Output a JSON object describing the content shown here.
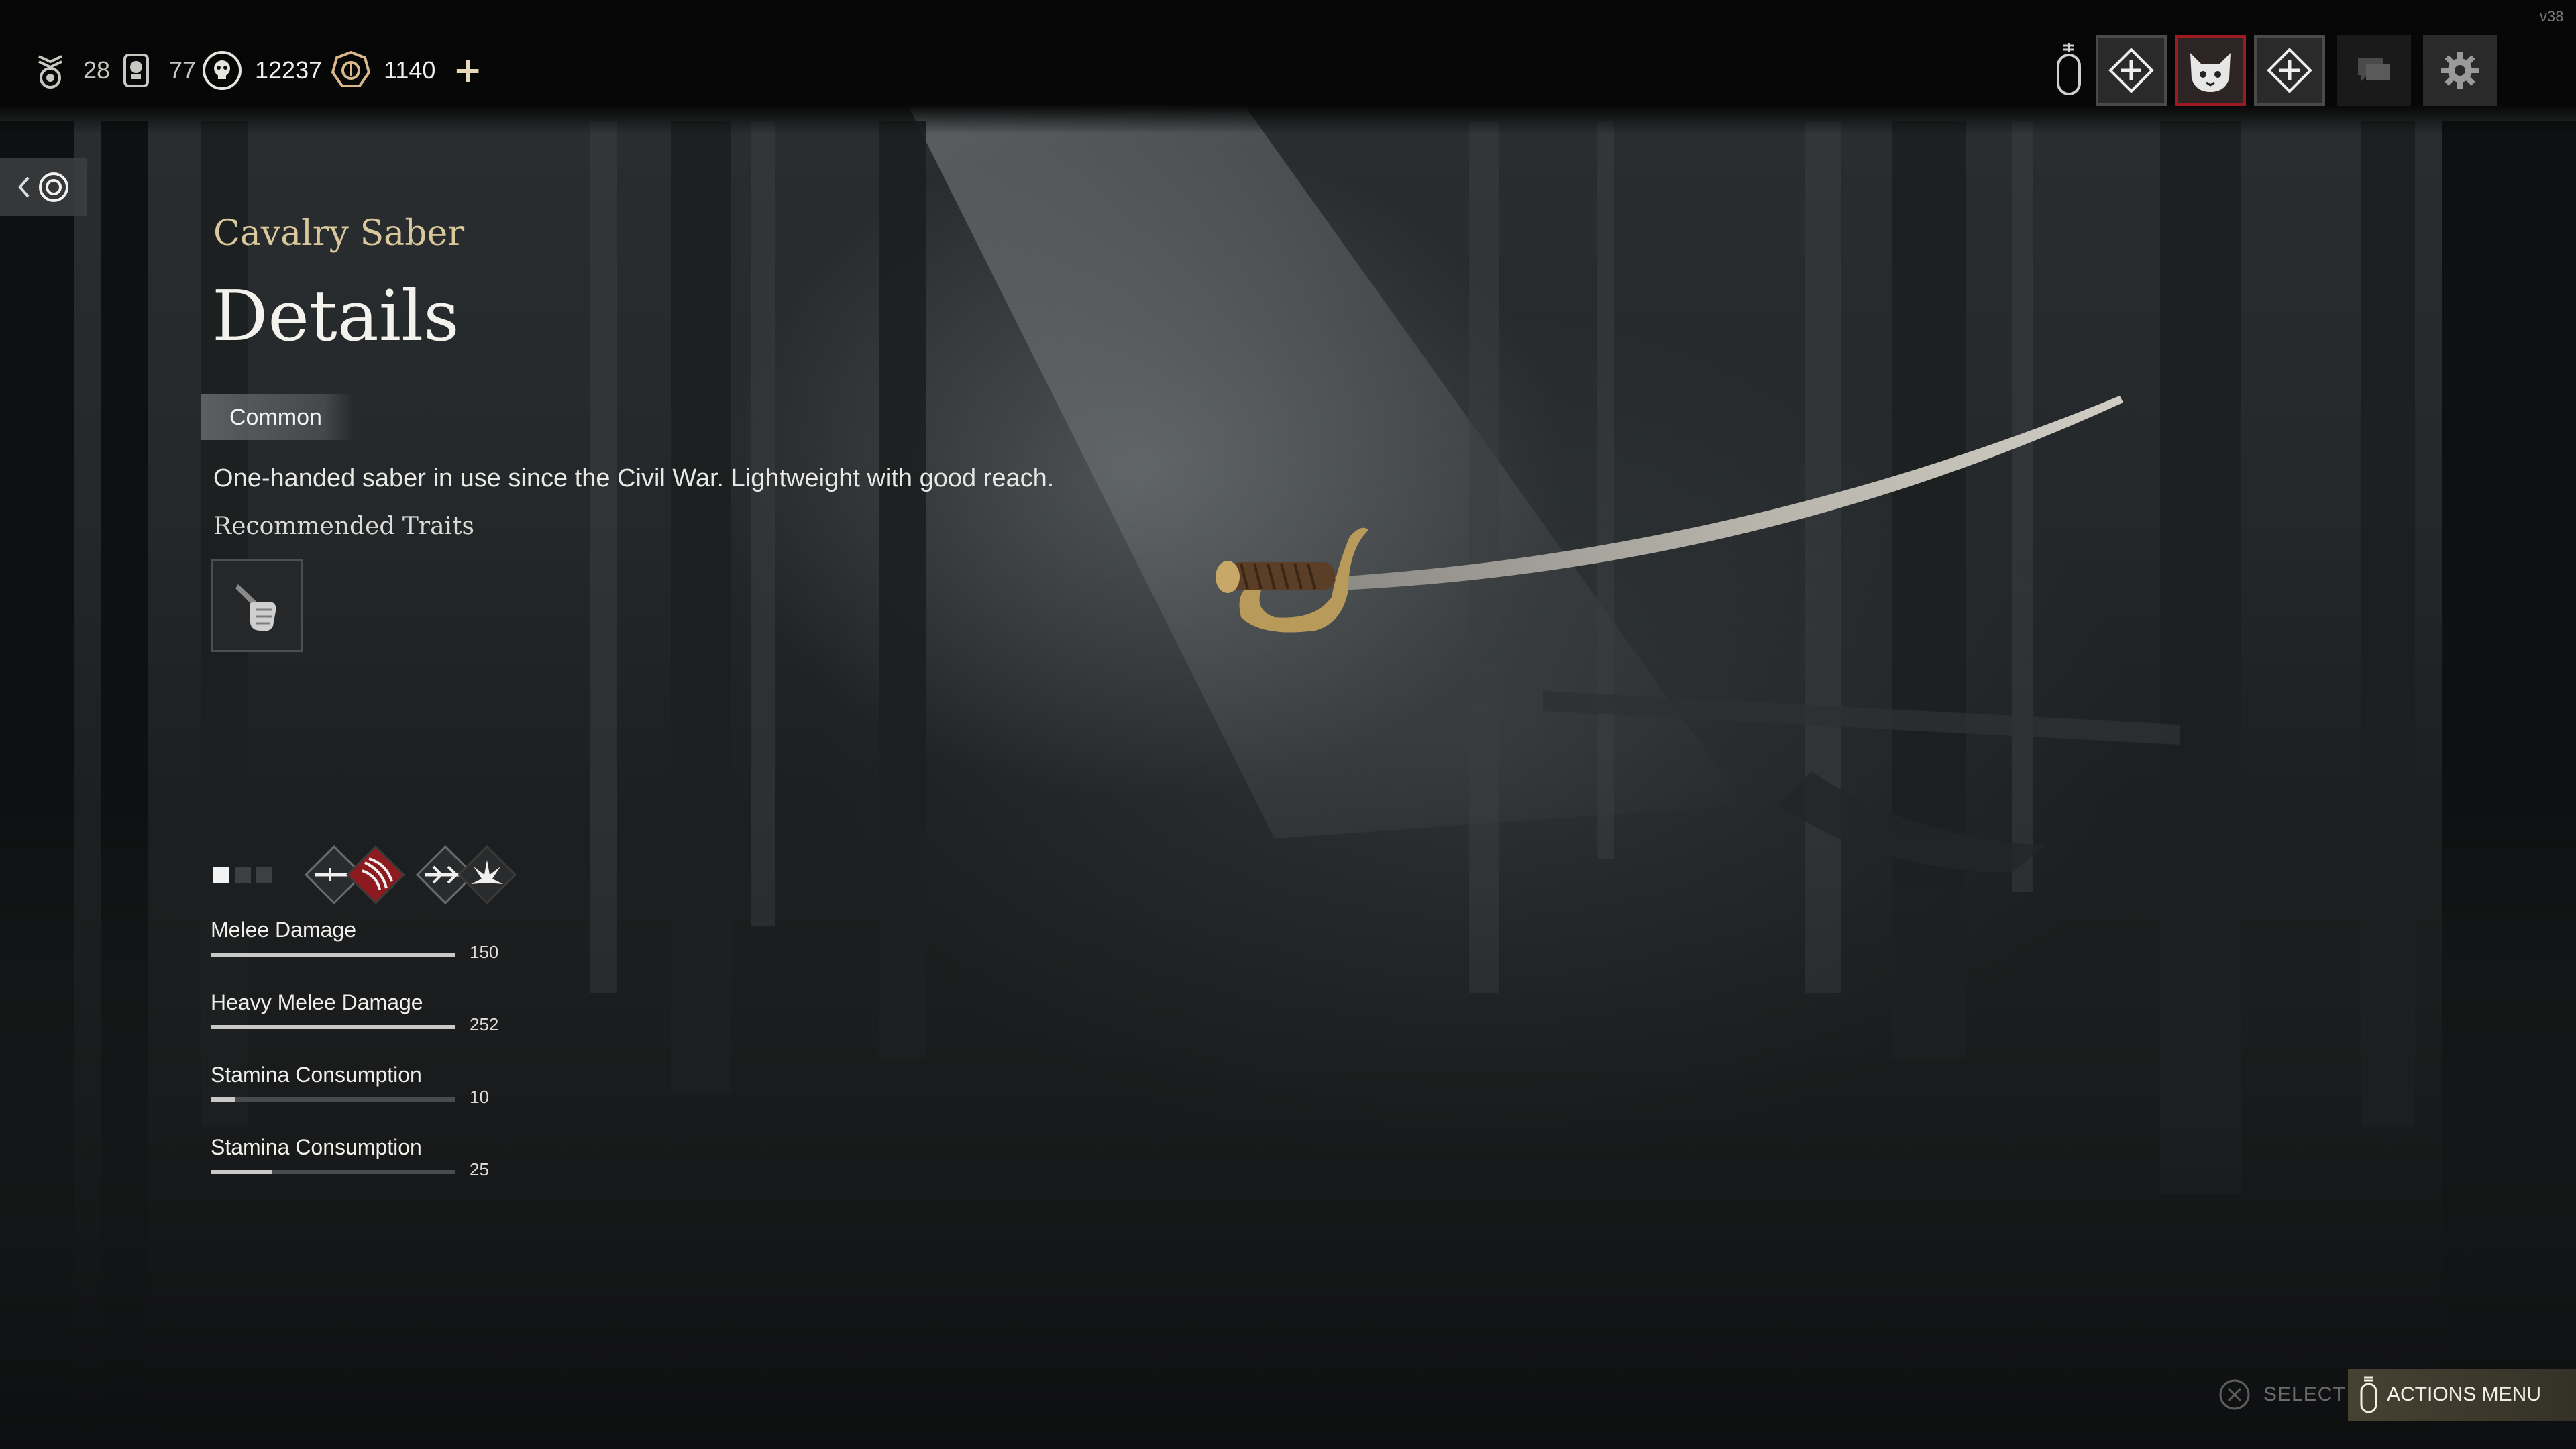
{
  "version": "v38",
  "currencies": [
    {
      "icon": "medal-icon",
      "value": "28"
    },
    {
      "icon": "skull-tag-icon",
      "value": "77"
    },
    {
      "icon": "skull-coin-icon",
      "value": "12237"
    },
    {
      "icon": "premium-coin-icon",
      "value": "1140"
    }
  ],
  "premium_plus": "+",
  "squad_slots": [
    {
      "icon": "add-player-icon",
      "active": false
    },
    {
      "icon": "cat-avatar-icon",
      "active": true
    },
    {
      "icon": "add-player-icon",
      "active": false
    }
  ],
  "weapon": {
    "subtitle": "Cavalry Saber",
    "title": "Details",
    "rarity": "Common",
    "description": "One-handed saber in use since the Civil War. Lightweight with good reach.",
    "recommended_label": "Recommended Traits",
    "trait_icon": "fist-knife-icon"
  },
  "stats": [
    {
      "label": "Melee Damage",
      "value": "150",
      "fill": 1.0
    },
    {
      "label": "Heavy Melee Damage",
      "value": "252",
      "fill": 1.0
    },
    {
      "label": "Stamina Consumption",
      "value": "10",
      "fill": 0.1
    },
    {
      "label": "Stamina Consumption",
      "value": "25",
      "fill": 0.25
    }
  ],
  "hints": {
    "select": "SELECT",
    "actions": "ACTIONS MENU"
  },
  "colors": {
    "accent_gold": "#d9c89c",
    "active_slot_border": "#9c1a22"
  }
}
